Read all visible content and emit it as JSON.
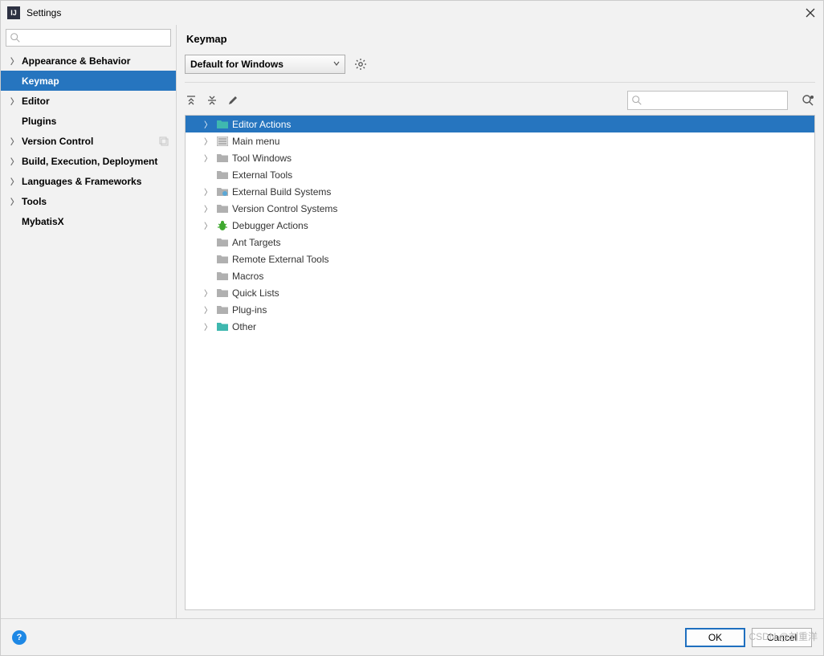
{
  "window": {
    "title": "Settings"
  },
  "sidebar": {
    "search_placeholder": "",
    "items": [
      {
        "label": "Appearance & Behavior",
        "bold": true,
        "chevron": true
      },
      {
        "label": "Keymap",
        "bold": true,
        "chevron": false,
        "selected": true,
        "indent": true
      },
      {
        "label": "Editor",
        "bold": true,
        "chevron": true
      },
      {
        "label": "Plugins",
        "bold": true,
        "chevron": false,
        "indent": true
      },
      {
        "label": "Version Control",
        "bold": true,
        "chevron": true,
        "copy_icon": true
      },
      {
        "label": "Build, Execution, Deployment",
        "bold": true,
        "chevron": true
      },
      {
        "label": "Languages & Frameworks",
        "bold": true,
        "chevron": true
      },
      {
        "label": "Tools",
        "bold": true,
        "chevron": true
      },
      {
        "label": "MybatisX",
        "bold": true,
        "chevron": false,
        "indent": true
      }
    ]
  },
  "page": {
    "title": "Keymap",
    "scheme_selected": "Default for Windows"
  },
  "action_search_placeholder": "",
  "tree": [
    {
      "label": "Editor Actions",
      "chevron": true,
      "icon": "folder-teal",
      "selected": true
    },
    {
      "label": "Main menu",
      "chevron": true,
      "icon": "menu"
    },
    {
      "label": "Tool Windows",
      "chevron": true,
      "icon": "folder"
    },
    {
      "label": "External Tools",
      "chevron": false,
      "icon": "folder"
    },
    {
      "label": "External Build Systems",
      "chevron": true,
      "icon": "ext"
    },
    {
      "label": "Version Control Systems",
      "chevron": true,
      "icon": "folder"
    },
    {
      "label": "Debugger Actions",
      "chevron": true,
      "icon": "bug"
    },
    {
      "label": "Ant Targets",
      "chevron": false,
      "icon": "folder"
    },
    {
      "label": "Remote External Tools",
      "chevron": false,
      "icon": "folder"
    },
    {
      "label": "Macros",
      "chevron": false,
      "icon": "folder"
    },
    {
      "label": "Quick Lists",
      "chevron": true,
      "icon": "folder"
    },
    {
      "label": "Plug-ins",
      "chevron": true,
      "icon": "folder"
    },
    {
      "label": "Other",
      "chevron": true,
      "icon": "folder-teal"
    }
  ],
  "footer": {
    "ok": "OK",
    "cancel": "Cancel"
  },
  "watermark": "CSDN @刘重洋"
}
